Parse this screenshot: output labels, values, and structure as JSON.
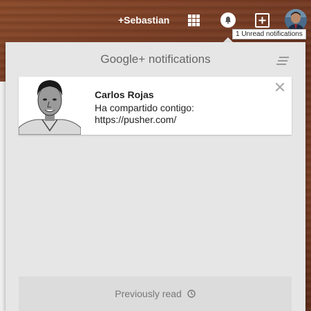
{
  "topbar": {
    "profile_name": "+Sebastian",
    "tooltip": "1 Unread notifications"
  },
  "panel": {
    "title": "Google+ notifications",
    "notification": {
      "name": "Carlos Rojas",
      "line1": "Ha compartido contigo:",
      "line2": "https://pusher.com/"
    },
    "previously_read_label": "Previously read"
  },
  "colors": {
    "panel_bg": "#e6e6e6",
    "card_bg": "#ffffff",
    "text_muted": "#777777"
  },
  "icons": [
    "apps-grid-icon",
    "bell-icon",
    "share-plus-icon",
    "avatar",
    "menu-lines-icon",
    "close-icon",
    "clock-icon"
  ]
}
